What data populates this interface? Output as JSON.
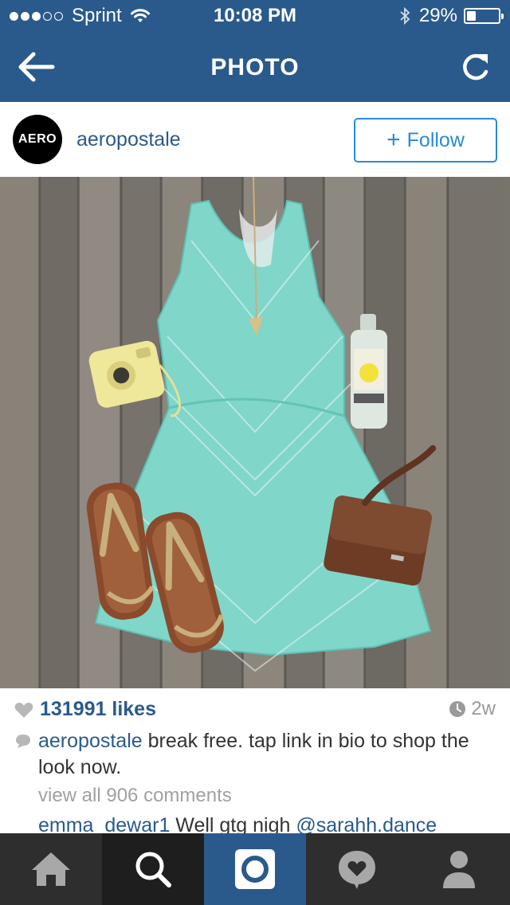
{
  "status_bar": {
    "carrier": "Sprint",
    "signal_bars_filled": 3,
    "signal_bars_total": 5,
    "time": "10:08 PM",
    "battery_percent": "29%",
    "battery_level": 0.29
  },
  "nav": {
    "title": "PHOTO",
    "back_icon": "arrow-left-icon",
    "refresh_icon": "refresh-icon"
  },
  "post": {
    "avatar_text": "AERO",
    "username": "aeropostale",
    "follow_label": "Follow",
    "likes": "131991 likes",
    "age": "2w",
    "caption_user": "aeropostale",
    "caption_text": " break free. tap link in bio to shop the look now.",
    "view_all_comments": "view all 906 comments",
    "comment_user": "emma_dewar1",
    "comment_text": " Well gtg nigh ",
    "comment_mention": "@sarahh.dance"
  },
  "tabbar": {
    "items": [
      "home-icon",
      "search-icon",
      "camera-icon",
      "activity-heart-icon",
      "profile-icon"
    ],
    "active": "camera-icon"
  },
  "colors": {
    "brand_blue": "#2a5a8c",
    "follow_blue": "#2a8ad8",
    "tabbar_bg": "#2e2e2e"
  }
}
